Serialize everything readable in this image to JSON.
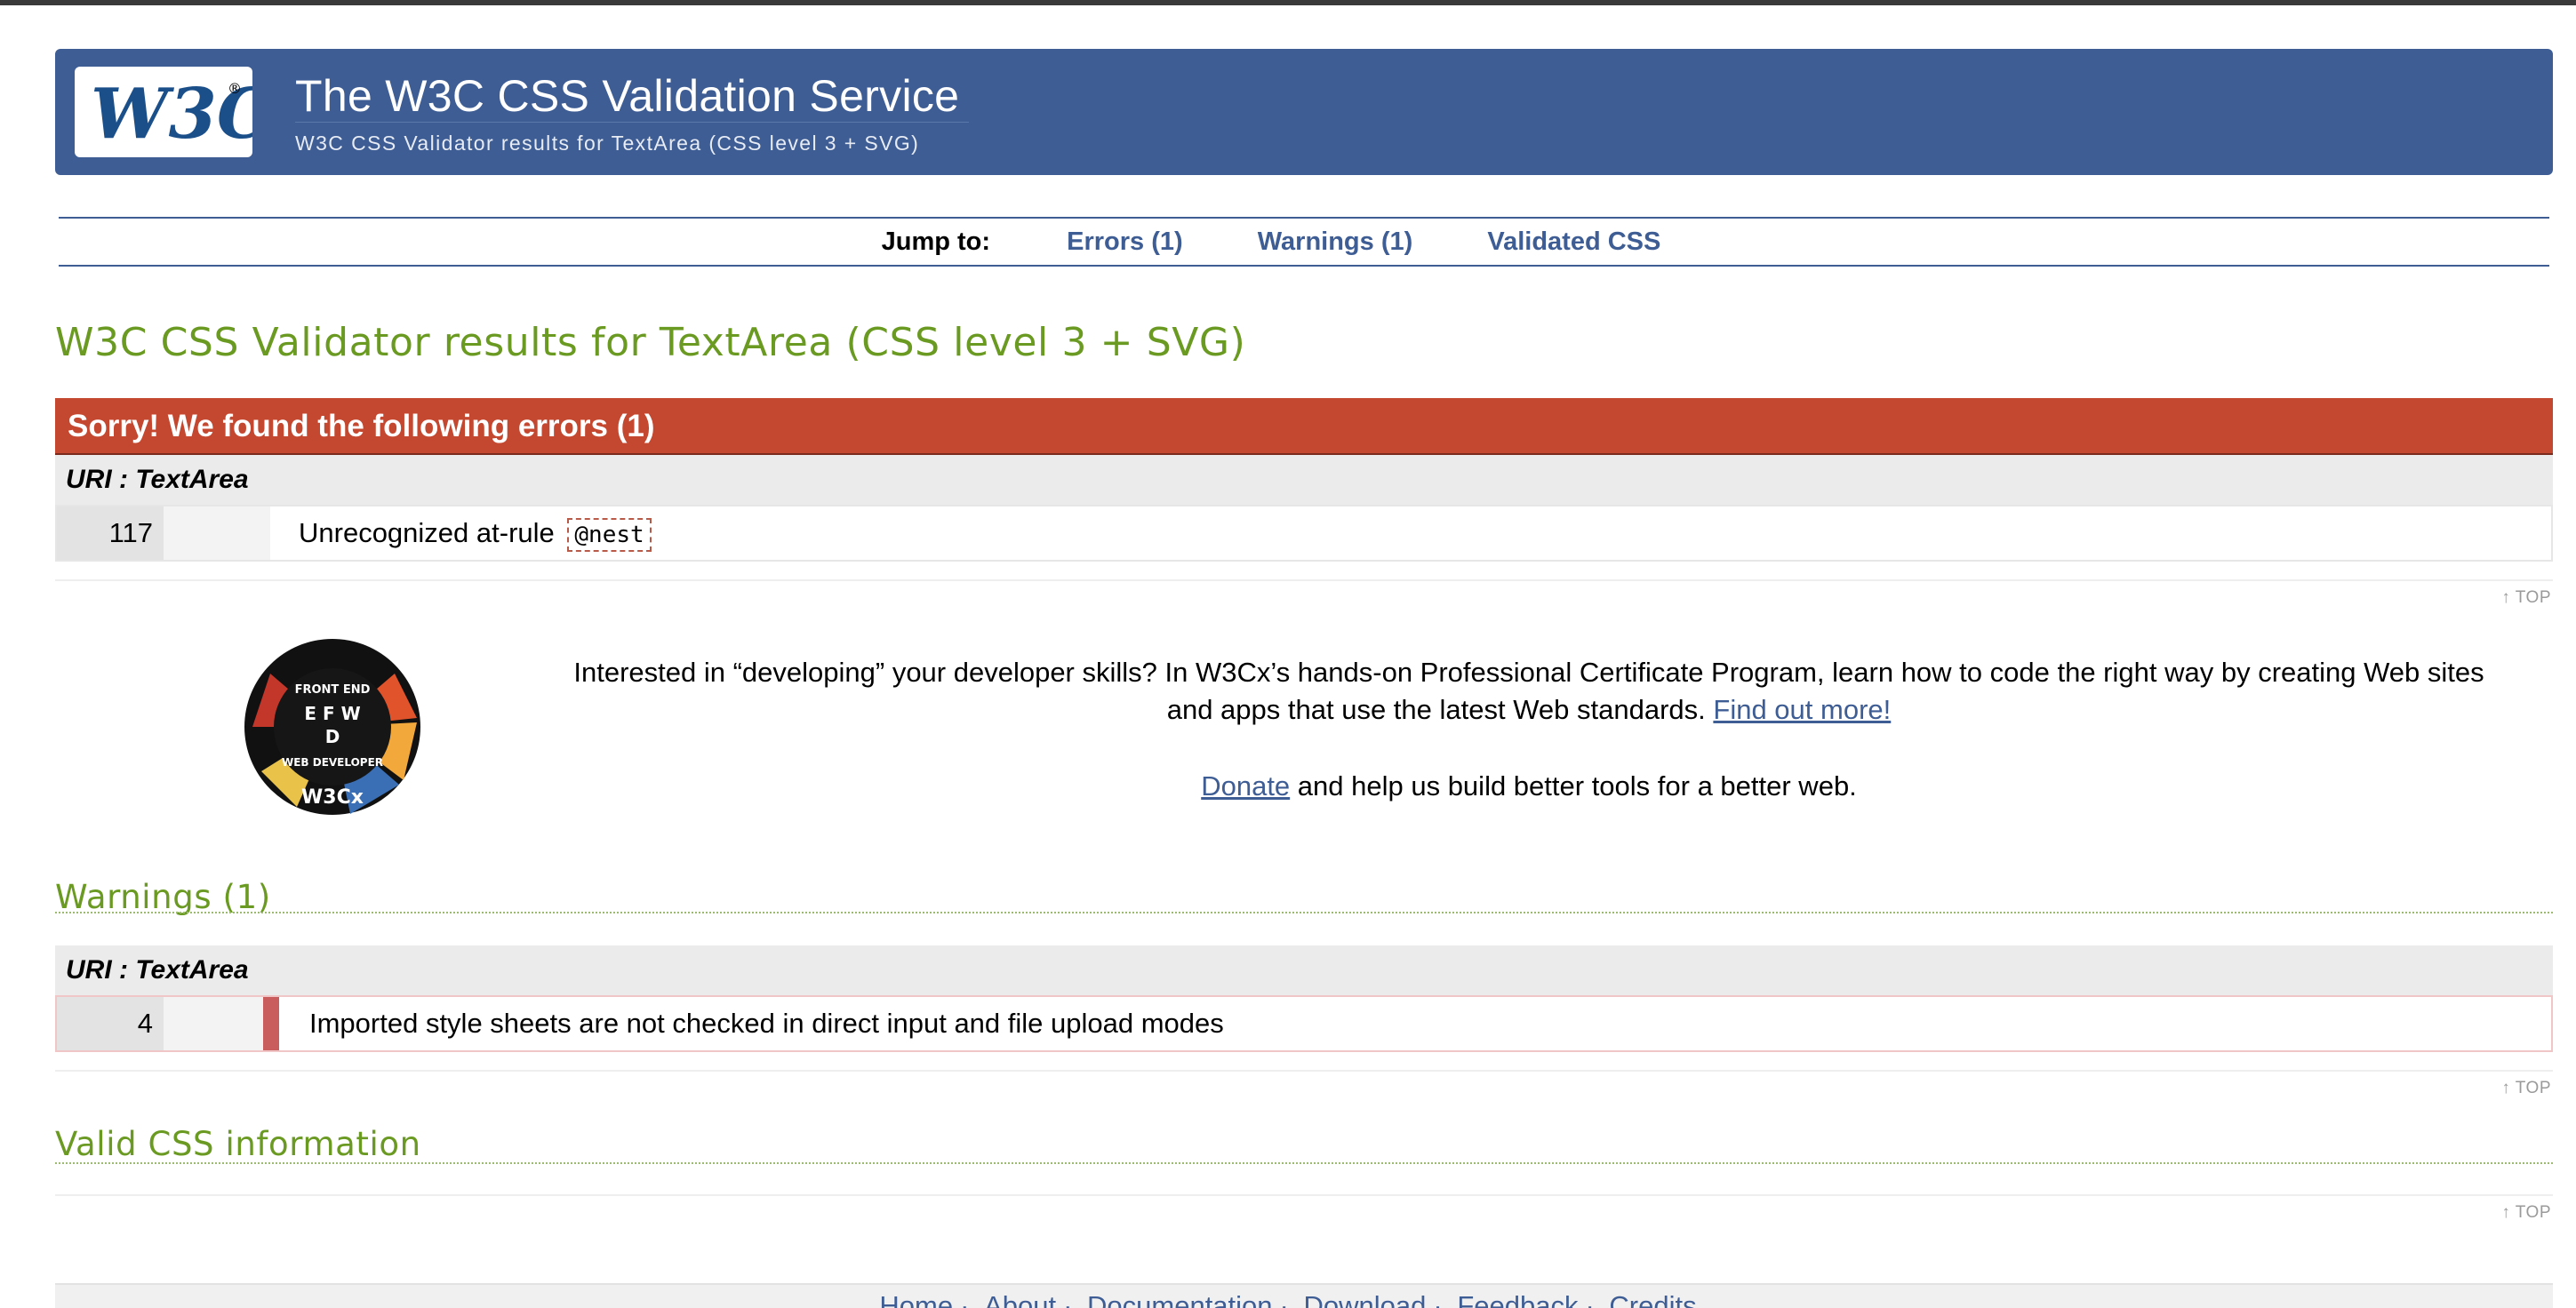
{
  "header": {
    "logo_text": "W3C",
    "title": "The W3C CSS Validation Service",
    "subtitle": "W3C CSS Validator results for TextArea (CSS level 3 + SVG)"
  },
  "jump": {
    "label": "Jump to:",
    "links": [
      "Errors (1)",
      "Warnings (1)",
      "Validated CSS"
    ]
  },
  "page_heading": "W3C CSS Validator results for TextArea (CSS level 3 + SVG)",
  "errors": {
    "banner": "Sorry! We found the following errors (1)",
    "uri": "URI : TextArea",
    "items": [
      {
        "line": "117",
        "message": "Unrecognized at-rule",
        "code": "@nest"
      }
    ]
  },
  "top_link": "↑ TOP",
  "promo": {
    "badge_text": "W3Cx",
    "text": "Interested in “developing” your developer skills? In W3Cx’s hands-on Professional Certificate Program, learn how to code the right way by creating Web sites and apps that use the latest Web standards.",
    "link": "Find out more!",
    "donate_link": "Donate",
    "donate_text": " and help us build better tools for a better web."
  },
  "warnings": {
    "heading": "Warnings (1)",
    "uri": "URI : TextArea",
    "items": [
      {
        "line": "4",
        "message": "Imported style sheets are not checked in direct input and file upload modes"
      }
    ]
  },
  "valid_css": {
    "heading": "Valid CSS information"
  },
  "footer": {
    "links": [
      "Home",
      "About",
      "Documentation",
      "Download",
      "Feedback",
      "Credits"
    ]
  },
  "colors": {
    "brand_blue": "#3e5d94",
    "error_red": "#c4472f",
    "heading_green": "#6a9a22"
  }
}
